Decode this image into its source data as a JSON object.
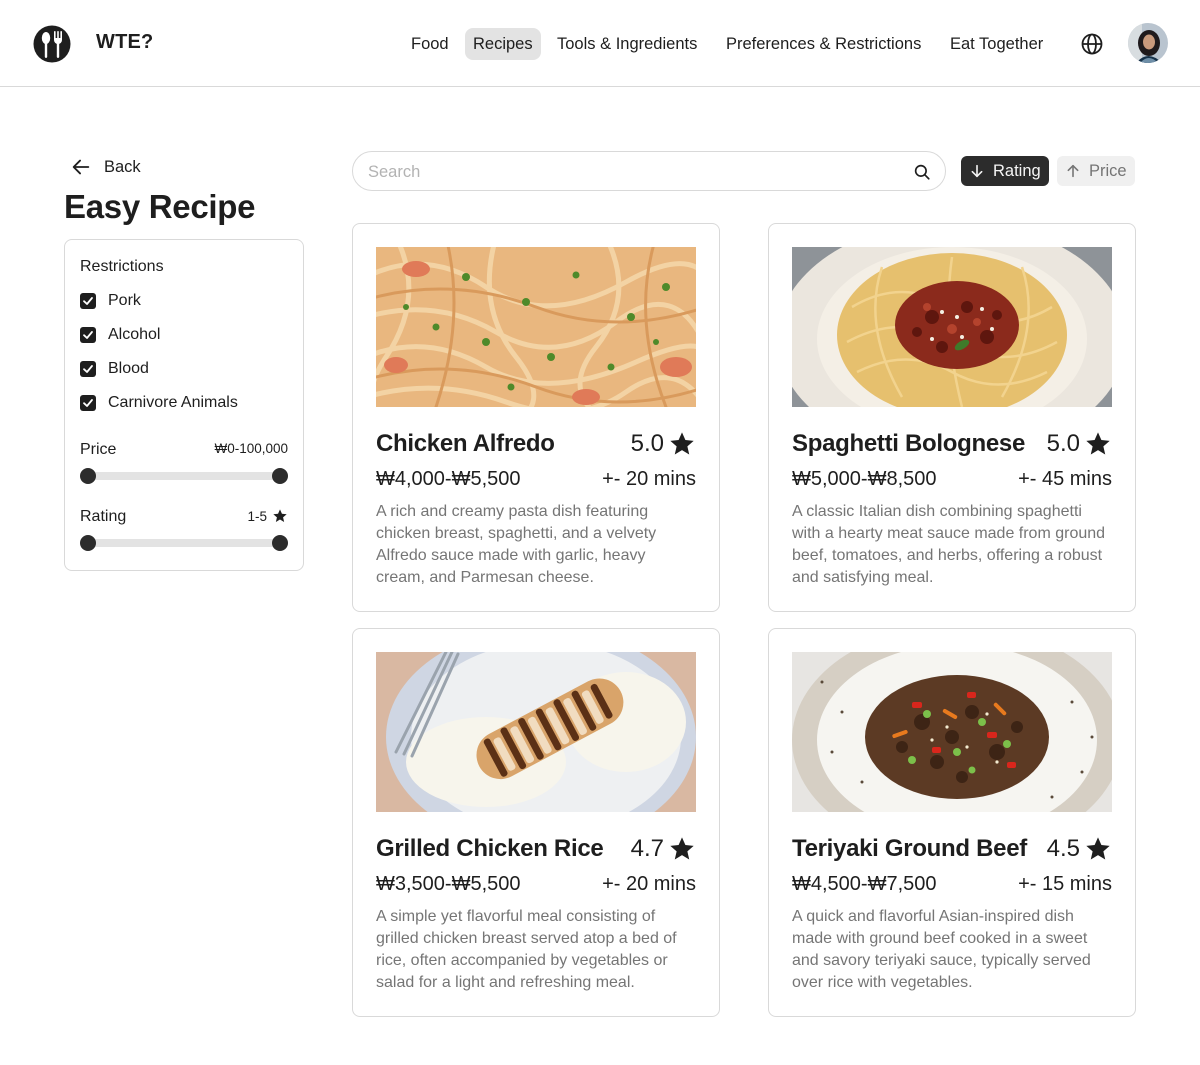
{
  "header": {
    "brand": "WTE?",
    "logo_icon": "fork-spoon-icon",
    "nav": [
      {
        "label": "Food",
        "active": false
      },
      {
        "label": "Recipes",
        "active": true
      },
      {
        "label": "Tools & Ingredients",
        "active": false
      },
      {
        "label": "Preferences & Restrictions",
        "active": false
      },
      {
        "label": "Eat Together",
        "active": false
      }
    ],
    "language_icon": "globe-icon",
    "avatar_icon": "user-avatar"
  },
  "sidebar": {
    "back_label": "Back",
    "page_title": "Easy Recipe",
    "filters": {
      "restrictions_heading": "Restrictions",
      "restrictions": [
        {
          "label": "Pork",
          "checked": true
        },
        {
          "label": "Alcohol",
          "checked": true
        },
        {
          "label": "Blood",
          "checked": true
        },
        {
          "label": "Carnivore Animals",
          "checked": true
        }
      ],
      "price": {
        "label": "Price",
        "value": "₩0-100,000"
      },
      "rating": {
        "label": "Rating",
        "value": "1-5",
        "icon": "star-icon"
      }
    }
  },
  "search": {
    "placeholder": "Search"
  },
  "sort": {
    "rating": {
      "label": "Rating",
      "direction": "down",
      "active": true
    },
    "price": {
      "label": "Price",
      "direction": "up",
      "active": false
    }
  },
  "recipes": [
    {
      "title": "Chicken Alfredo",
      "rating": "5.0",
      "price": "₩4,000-₩5,500",
      "time": "+- 20 mins",
      "description": "A rich and creamy pasta dish featuring chicken breast, spaghetti, and a velvety Alfredo sauce made with garlic, heavy cream, and Parmesan cheese."
    },
    {
      "title": "Spaghetti Bolognese",
      "rating": "5.0",
      "price": "₩5,000-₩8,500",
      "time": "+- 45 mins",
      "description": "A classic Italian dish combining spaghetti with a hearty meat sauce made from ground beef, tomatoes, and herbs, offering a robust and satisfying meal."
    },
    {
      "title": "Grilled Chicken Rice",
      "rating": "4.7",
      "price": "₩3,500-₩5,500",
      "time": "+- 20 mins",
      "description": "A simple yet flavorful meal consisting of grilled chicken breast served atop a bed of rice, often accompanied by vegetables or salad for a light and refreshing meal."
    },
    {
      "title": "Teriyaki Ground Beef",
      "rating": "4.5",
      "price": "₩4,500-₩7,500",
      "time": "+- 15 mins",
      "description": "A quick and flavorful Asian-inspired dish made with ground beef cooked in a sweet and savory teriyaki sauce, typically served over rice with vegetables."
    }
  ]
}
